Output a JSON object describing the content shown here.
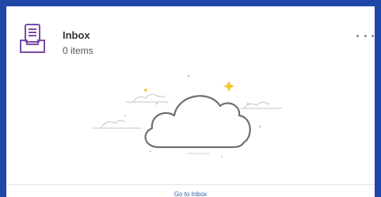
{
  "card": {
    "title": "Inbox",
    "count_text": "0 items",
    "footer_link": "Go to Inbox",
    "more_icon": "more-horizontal-icon",
    "main_icon": "inbox-tray-icon",
    "illustration": "cloud-illustration"
  },
  "colors": {
    "frame": "#1f47a8",
    "icon_purple": "#7a4ba6",
    "sparkle": "#f4c430",
    "link": "#2a5db0"
  }
}
